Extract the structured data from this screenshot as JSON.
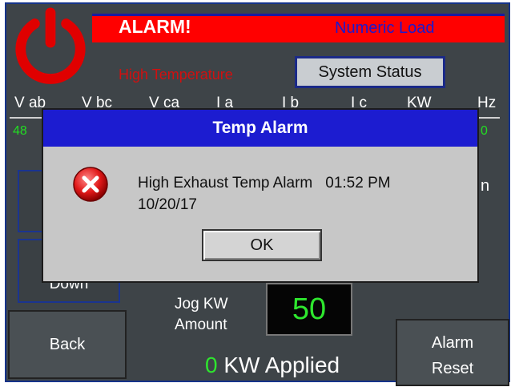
{
  "header": {
    "alarm_title": "ALARM!",
    "mode": "Numeric Load",
    "alarm_reason": "High Temperature",
    "system_status_label": "System Status"
  },
  "meters": {
    "headers": [
      "V ab",
      "V bc",
      "V ca",
      "I a",
      "I b",
      "I c",
      "KW",
      "Hz"
    ],
    "left_value_fragment": "48",
    "right_value_fragment": "0"
  },
  "side": {
    "down_label": "Down",
    "right_fragment": "n"
  },
  "jog": {
    "label_line1": "Jog KW",
    "label_line2": "Amount",
    "amount": "50"
  },
  "footer": {
    "back_label": "Back",
    "reset_line1": "Alarm",
    "reset_line2": "Reset",
    "applied_value": "0",
    "applied_label": " KW Applied"
  },
  "dialog": {
    "title": "Temp Alarm",
    "message": "High Exhaust Temp Alarm",
    "time": "01:52 PM",
    "date": "10/20/17",
    "ok_label": "OK"
  },
  "colors": {
    "header_red": "#ff0000",
    "accent_blue": "#1a1ad0",
    "screen_bg": "#3e4448",
    "value_green": "#2ee62e",
    "dialog_bg": "#c7c7c7"
  },
  "icons": {
    "power": "power-icon",
    "error": "error-circle-icon"
  }
}
